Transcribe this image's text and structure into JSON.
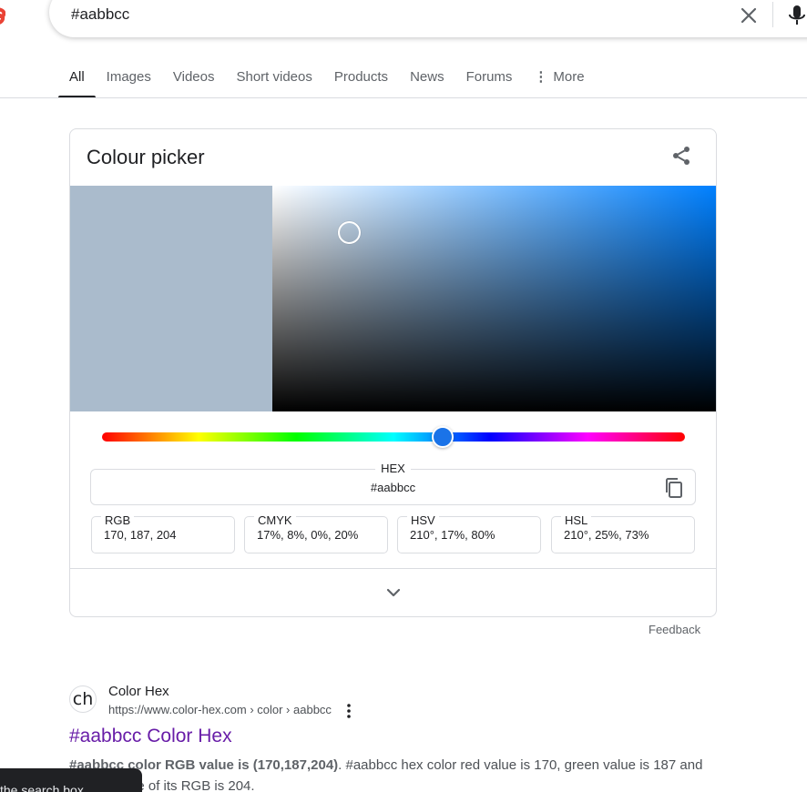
{
  "search": {
    "query": "#aabbcc",
    "clear_icon": "close-icon",
    "mic_icon": "microphone-icon"
  },
  "tabs": [
    {
      "label": "All",
      "active": true
    },
    {
      "label": "Images"
    },
    {
      "label": "Videos"
    },
    {
      "label": "Short videos"
    },
    {
      "label": "Products"
    },
    {
      "label": "News"
    },
    {
      "label": "Forums"
    },
    {
      "label": "More",
      "icon": "more-vert-icon"
    }
  ],
  "colour_picker": {
    "title": "Colour picker",
    "share_icon": "share-icon",
    "swatch_color": "#aabbcc",
    "hue_color": "#0080ff",
    "hue_fraction": 0.583,
    "saturation_percent": 17,
    "value_percent": 80,
    "hex_label": "HEX",
    "hex_value": "#aabbcc",
    "copy_icon": "copy-icon",
    "fields": [
      {
        "label": "RGB",
        "value": "170, 187, 204"
      },
      {
        "label": "CMYK",
        "value": "17%, 8%, 0%, 20%"
      },
      {
        "label": "HSV",
        "value": "210°, 17%, 80%"
      },
      {
        "label": "HSL",
        "value": "210°, 25%, 73%"
      }
    ],
    "expand_icon": "chevron-down-icon"
  },
  "feedback": "Feedback",
  "result": {
    "favicon_text": "ch",
    "site_name": "Color Hex",
    "url": "https://www.color-hex.com › color › aabbcc",
    "title": "#aabbcc Color Hex",
    "snippet_bold": "#aabbcc color RGB value is (170,187,204)",
    "snippet_rest": ". #aabbcc hex color red value is 170, green value is 187 and",
    "snippet_line2": "ue of its RGB is 204."
  },
  "toast": {
    "text": "the search box"
  },
  "colors": {
    "visited_link": "#681da8",
    "accent_blue": "#1a73e8",
    "logo_red": "#ea4335"
  }
}
